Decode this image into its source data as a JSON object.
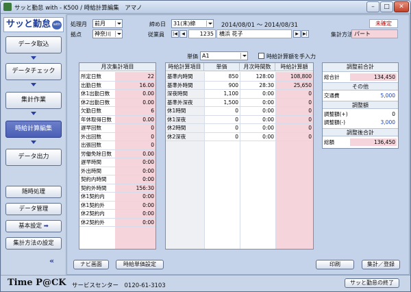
{
  "window": {
    "title": "サッと勤怠 with - K500 / 時給計算編集　アマノ"
  },
  "sidebar": {
    "logo_text": "サッと勤怠",
    "logo_badge": "with",
    "steps": [
      {
        "label": "データ取込"
      },
      {
        "label": "データチェック"
      },
      {
        "label": "集計作業"
      },
      {
        "label": "時給計算編集"
      },
      {
        "label": "データ出力"
      }
    ],
    "tools": [
      {
        "label": "随時処理"
      },
      {
        "label": "データ管理"
      },
      {
        "label": "基本設定"
      },
      {
        "label": "集計方法の設定"
      }
    ]
  },
  "header": {
    "month_label": "処理月",
    "month_value": "前月",
    "close_label": "締め日",
    "close_value": "31(末)締",
    "date_range": "2014/08/01 ～ 2014/08/31",
    "status": "未確定",
    "site_label": "拠点",
    "site_value": "神奈川",
    "employee_label": "従業員",
    "employee_code": "1235",
    "employee_name": "横浜 花子",
    "method_label": "集計方法",
    "method_value": "パート",
    "unit_label": "単価",
    "unit_value": "A1",
    "manual_label": "時給計算額を手入力"
  },
  "monthly": {
    "title": "月次集計項目",
    "rows": [
      {
        "label": "所定日数",
        "value": "22"
      },
      {
        "label": "出勤日数",
        "value": "16.00"
      },
      {
        "label": "休1出勤日数",
        "value": "0.00"
      },
      {
        "label": "休2出勤日数",
        "value": "0.00"
      },
      {
        "label": "欠勤日数",
        "value": "6"
      },
      {
        "label": "年休取得日数",
        "value": "0.00"
      },
      {
        "label": "遅早回数",
        "value": "0"
      },
      {
        "label": "外出回数",
        "value": "0"
      },
      {
        "label": "出張回数",
        "value": "0"
      },
      {
        "label": "労働免除日数",
        "value": "0.00"
      },
      {
        "label": "遅早時間",
        "value": "0:00"
      },
      {
        "label": "外出時間",
        "value": "0:00"
      },
      {
        "label": "契約内時間",
        "value": "0:00"
      },
      {
        "label": "契約外時間",
        "value": "156:30"
      },
      {
        "label": "休1契約内",
        "value": "0:00"
      },
      {
        "label": "休1契約外",
        "value": "0:00"
      },
      {
        "label": "休2契約内",
        "value": "0:00"
      },
      {
        "label": "休2契約外",
        "value": "0:00"
      }
    ]
  },
  "hourly": {
    "headers": [
      "時給計算項目",
      "単価",
      "月次時間数",
      "時給計算額"
    ],
    "rows": [
      {
        "item": "基準内時間",
        "rate": "850",
        "hours": "128:00",
        "amount": "108,800"
      },
      {
        "item": "基準外時間",
        "rate": "900",
        "hours": "28:30",
        "amount": "25,650"
      },
      {
        "item": "深夜時間",
        "rate": "1,100",
        "hours": "0:00",
        "amount": "0"
      },
      {
        "item": "基準外深夜",
        "rate": "1,500",
        "hours": "0:00",
        "amount": "0"
      },
      {
        "item": "休1時間",
        "rate": "0",
        "hours": "0:00",
        "amount": "0"
      },
      {
        "item": "休1深夜",
        "rate": "0",
        "hours": "0:00",
        "amount": "0"
      },
      {
        "item": "休2時間",
        "rate": "0",
        "hours": "0:00",
        "amount": "0"
      },
      {
        "item": "休2深夜",
        "rate": "0",
        "hours": "0:00",
        "amount": "0"
      }
    ]
  },
  "summary": {
    "adjust_title": "調整前合計",
    "total_label": "総合計",
    "total_value": "134,450",
    "other_title": "その他",
    "transport_label": "交通費",
    "transport_value": "5,000",
    "adj_title": "調整額",
    "adj_plus_label": "調整額(+)",
    "adj_plus_value": "0",
    "adj_minus_label": "調整額(-)",
    "adj_minus_value": "3,000",
    "after_title": "調整後合計",
    "gross_label": "総額",
    "gross_value": "136,450"
  },
  "footer": {
    "nav_button": "ナビ画面",
    "rate_button": "時給単価設定",
    "print_button": "印刷",
    "register_button": "集計／登録",
    "brand": "Time P@CK",
    "service_text": "サービスセンター　0120-61-3103",
    "exit_button": "サッと勤怠の終了"
  },
  "colors": {
    "accent": "#4a5fb6",
    "pink": "#f5d4db",
    "status_red": "#cc0000",
    "blue_value": "#1d3fc0"
  }
}
